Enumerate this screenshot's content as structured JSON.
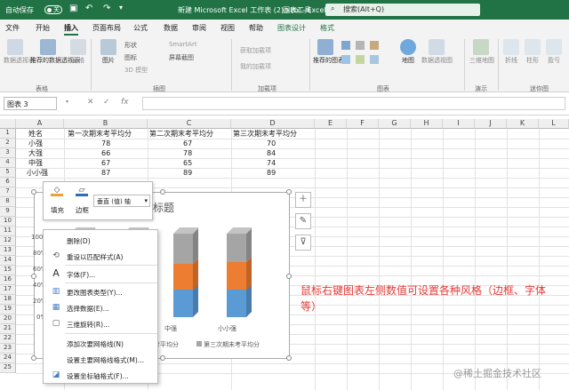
{
  "titlebar": {
    "autosave": "自动保存",
    "toggle": "关",
    "title": "新建 Microsoft Excel 工作表 (2).xlsx",
    "separator": "-",
    "app": "Excel",
    "context": "图表工具",
    "search_placeholder": "搜索(Alt+Q)"
  },
  "tabs": [
    "文件",
    "开始",
    "插入",
    "页面布局",
    "公式",
    "数据",
    "审阅",
    "视图",
    "帮助",
    "图表设计",
    "格式"
  ],
  "ribbon": {
    "pivot": "数据透视表",
    "recpivot": "推荐的数据透视表",
    "table": "表格",
    "tables_grp": "表格",
    "pictures": "图片",
    "shapes": "形状",
    "icons": "图标",
    "models": "3D 模型",
    "smartart": "SmartArt",
    "screenshot": "屏幕截图",
    "illus_grp": "插图",
    "getaddins": "获取加载项",
    "myaddins": "我的加载项",
    "addins_grp": "加载项",
    "recchart": "推荐的图表",
    "maps": "地图",
    "pivotchart": "数据透视图",
    "charts_grp": "图表",
    "3dmap": "三维地图",
    "tours_grp": "演示",
    "line": "折线",
    "column": "柱形",
    "winloss": "盈亏",
    "spark_grp": "迷你图"
  },
  "formula": {
    "namebox": "图表 3",
    "fx": "fx",
    "cancel": "✕",
    "enter": "✓"
  },
  "columns": [
    "A",
    "B",
    "C",
    "D",
    "E",
    "F",
    "G",
    "H",
    "I",
    "J",
    "K",
    "L"
  ],
  "rows": [
    "1",
    "2",
    "3",
    "4",
    "5",
    "6",
    "7",
    "8",
    "9",
    "10",
    "11",
    "12",
    "13",
    "14",
    "15",
    "16",
    "17",
    "18",
    "19",
    "20",
    "21",
    "22",
    "23",
    "24",
    "25"
  ],
  "cells": {
    "r1": [
      "姓名",
      "第一次期末考平均分",
      "第二次期末考平均分",
      "第三次期末考平均分"
    ],
    "r2": [
      "小强",
      "78",
      "67",
      "70"
    ],
    "r3": [
      "大强",
      "66",
      "78",
      "84"
    ],
    "r4": [
      "中强",
      "67",
      "65",
      "74"
    ],
    "r5": [
      "小小强",
      "87",
      "89",
      "89"
    ]
  },
  "chart": {
    "title": "标题",
    "y_ticks": [
      "100%",
      "80%",
      "60%",
      "40%",
      "20%",
      "0%"
    ],
    "categories": [
      "小强",
      "大强",
      "中强",
      "小小强"
    ],
    "visible_category_labels": [
      "中强",
      "小小强"
    ],
    "legend_partial": "考平均分",
    "legend3": "第三次期末考平均分",
    "colors": {
      "s1": "#5b9bd5",
      "s2": "#ed7d31",
      "s3": "#a5a5a5"
    }
  },
  "chart_data": {
    "type": "bar",
    "title": "标题",
    "categories": [
      "小强",
      "大强",
      "中强",
      "小小强"
    ],
    "series": [
      {
        "name": "第一次期末考平均分",
        "values": [
          78,
          66,
          67,
          87
        ]
      },
      {
        "name": "第二次期末考平均分",
        "values": [
          67,
          78,
          65,
          89
        ]
      },
      {
        "name": "第三次期末考平均分",
        "values": [
          70,
          84,
          74,
          89
        ]
      }
    ],
    "stacked": "percent",
    "ylim": [
      0,
      100
    ],
    "legend": "bottom"
  },
  "mini_toolbar": {
    "fill": "填充",
    "border": "边框",
    "axis": "垂直 (值) 轴"
  },
  "context_menu": [
    "删除(D)",
    "重设以匹配样式(A)",
    "字体(F)...",
    "更改图表类型(Y)...",
    "选择数据(E)...",
    "三维旋转(R)...",
    "添加次要网格线(N)",
    "设置主要网格线格式(M)...",
    "设置坐标轴格式(F)..."
  ],
  "annotation": "鼠标右键图表左侧数值可设置各种风格（边框、字体等）",
  "watermark": "@稀土掘金技术社区"
}
